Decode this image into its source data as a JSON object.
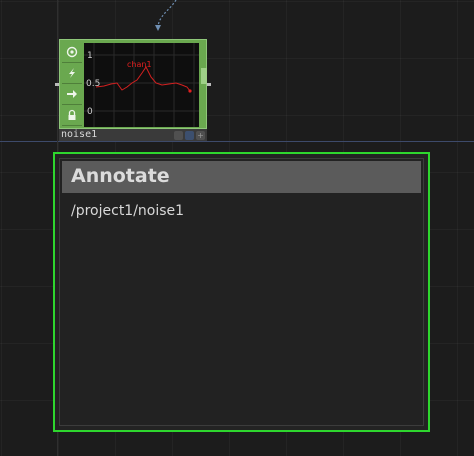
{
  "node": {
    "name": "noise1",
    "viewer": {
      "channel_label": "chan1",
      "y_labels": [
        "1",
        "0.5",
        "0"
      ],
      "line_color": "#e02020"
    }
  },
  "annotate": {
    "title": "Annotate",
    "body": "/project1/noise1",
    "border_color": "#2ed62e"
  },
  "colors": {
    "node_green": "#6aa84f",
    "background": "#1c1c1c"
  }
}
